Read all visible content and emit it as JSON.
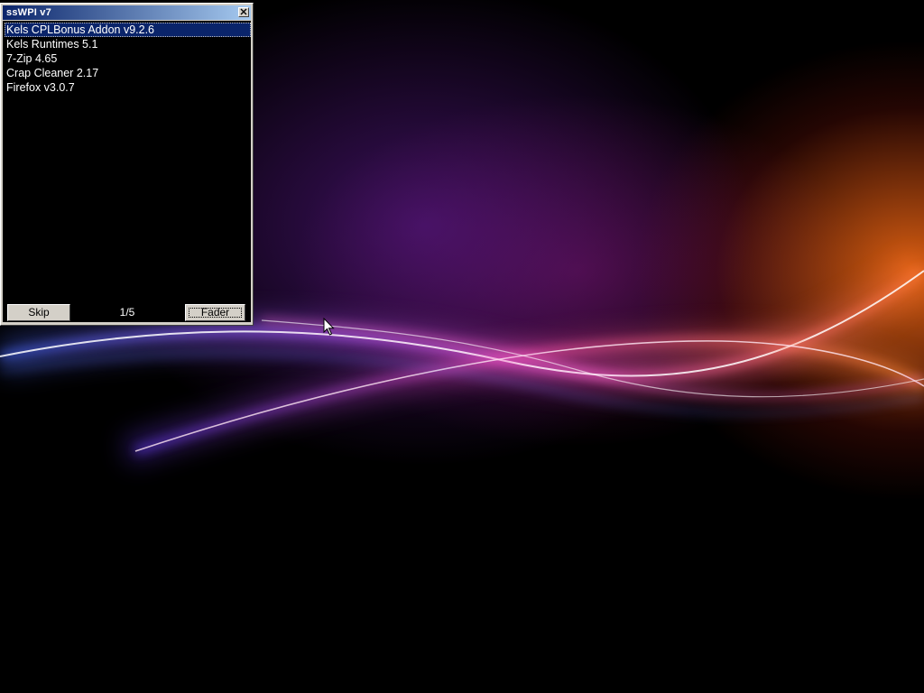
{
  "window": {
    "title": "ssWPI v7",
    "close_icon": "close-icon"
  },
  "list": {
    "items": [
      {
        "label": "Kels CPLBonus Addon v9.2.6",
        "selected": true
      },
      {
        "label": "Kels Runtimes 5.1",
        "selected": false
      },
      {
        "label": "7-Zip 4.65",
        "selected": false
      },
      {
        "label": "Crap Cleaner 2.17",
        "selected": false
      },
      {
        "label": "Firefox v3.0.7",
        "selected": false
      }
    ]
  },
  "footer": {
    "skip_label": "Skip",
    "progress": "1/5",
    "fader_label": "Fader"
  },
  "colors": {
    "titlebar_start": "#0a246a",
    "titlebar_end": "#a6caf0",
    "selection": "#0a246a",
    "list_background": "#000000",
    "list_text": "#ffffff",
    "button_face": "#d4d0c8"
  }
}
